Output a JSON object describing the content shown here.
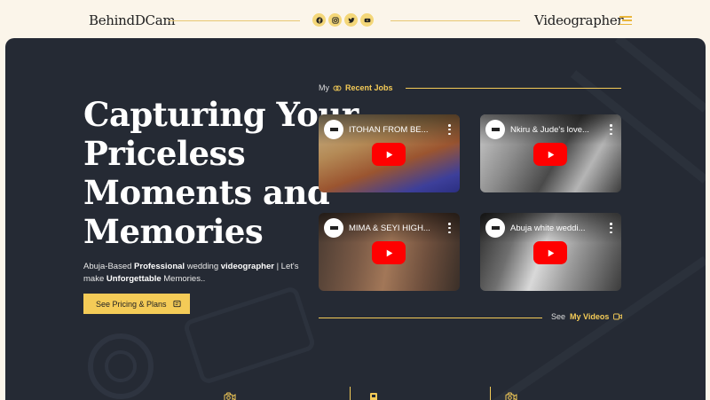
{
  "header": {
    "logo": "BehindDCam",
    "brand_right": "Videographer",
    "socials": [
      "facebook-icon",
      "instagram-icon",
      "twitter-icon",
      "youtube-icon"
    ],
    "menu_icon": "hamburger-icon"
  },
  "hero": {
    "headline_lines": [
      "Capturing Your",
      "Priceless",
      "Moments and",
      "Memories"
    ],
    "sub_parts": {
      "p1": "Abuja-Based ",
      "b1": "Professional",
      "p2": " wedding ",
      "b2": "videographer",
      "p3": " | Let's make ",
      "b3": "Unforgettable",
      "p4": " Memories.."
    },
    "cta_label": "See Pricing & Plans"
  },
  "recent_jobs": {
    "prefix": "My",
    "label": "Recent Jobs",
    "videos": [
      {
        "title": "ITOHAN FROM BE..."
      },
      {
        "title": "Nkiru & Jude's love..."
      },
      {
        "title": "MIMA & SEYI HIGH..."
      },
      {
        "title": "Abuja white weddi..."
      }
    ]
  },
  "my_videos": {
    "prefix": "See",
    "label": "My Videos"
  },
  "colors": {
    "accent": "#f4cb57",
    "panel": "#252a34",
    "page_bg": "#fbf5ea",
    "youtube_red": "#ff0000"
  }
}
